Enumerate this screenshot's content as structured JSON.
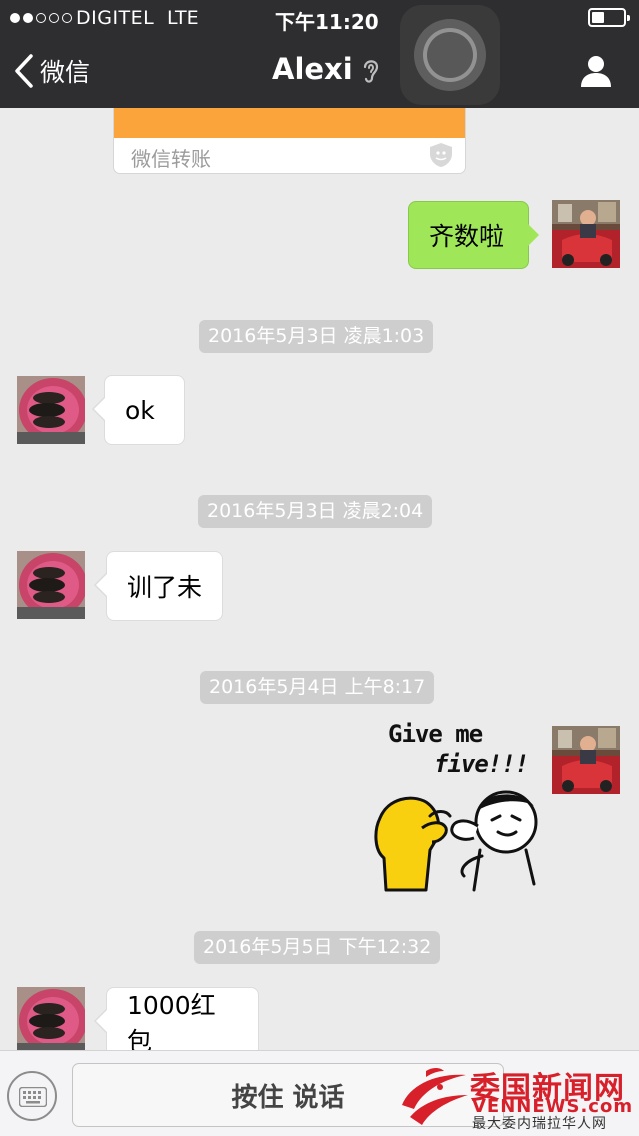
{
  "status_bar": {
    "signal_bars_filled": 2,
    "signal_bars_total": 5,
    "carrier": "DIGITEL",
    "network": "LTE",
    "time": "下午11:20",
    "battery_level": 0.4
  },
  "nav": {
    "back_label": "微信",
    "title": "Alexi",
    "title_icon": "ear-icon",
    "right_icon": "contact-icon"
  },
  "transfer_card": {
    "label": "微信转账",
    "icon": "shield-icon",
    "header_color": "#fba43c"
  },
  "messages": [
    {
      "direction": "out",
      "text": "齐数啦"
    },
    {
      "timestamp": "2016年5月3日 凌晨1:03"
    },
    {
      "direction": "in",
      "text": "ok"
    },
    {
      "timestamp": "2016年5月3日 凌晨2:04"
    },
    {
      "direction": "in",
      "text": "训了未"
    },
    {
      "timestamp": "2016年5月4日 上午8:17"
    },
    {
      "direction": "out",
      "sticker": {
        "line1": "Give me",
        "line2": "five!!!"
      }
    },
    {
      "timestamp": "2016年5月5日 下午12:32"
    },
    {
      "direction": "in",
      "text": "1000红包"
    }
  ],
  "input_bar": {
    "left_icon": "keyboard-icon",
    "hold_to_talk_label": "按住 说话"
  },
  "watermark": {
    "name": "委国新闻网",
    "latin": "VENNEWS.com",
    "tagline": "最大委内瑞拉华人网"
  },
  "colors": {
    "nav_background": "#2e2e30",
    "chat_background": "#ebebeb",
    "outgoing_bubble": "#9fe658",
    "incoming_bubble": "#ffffff",
    "timestamp_pill": "#cecece",
    "watermark_red": "#d7202a"
  }
}
